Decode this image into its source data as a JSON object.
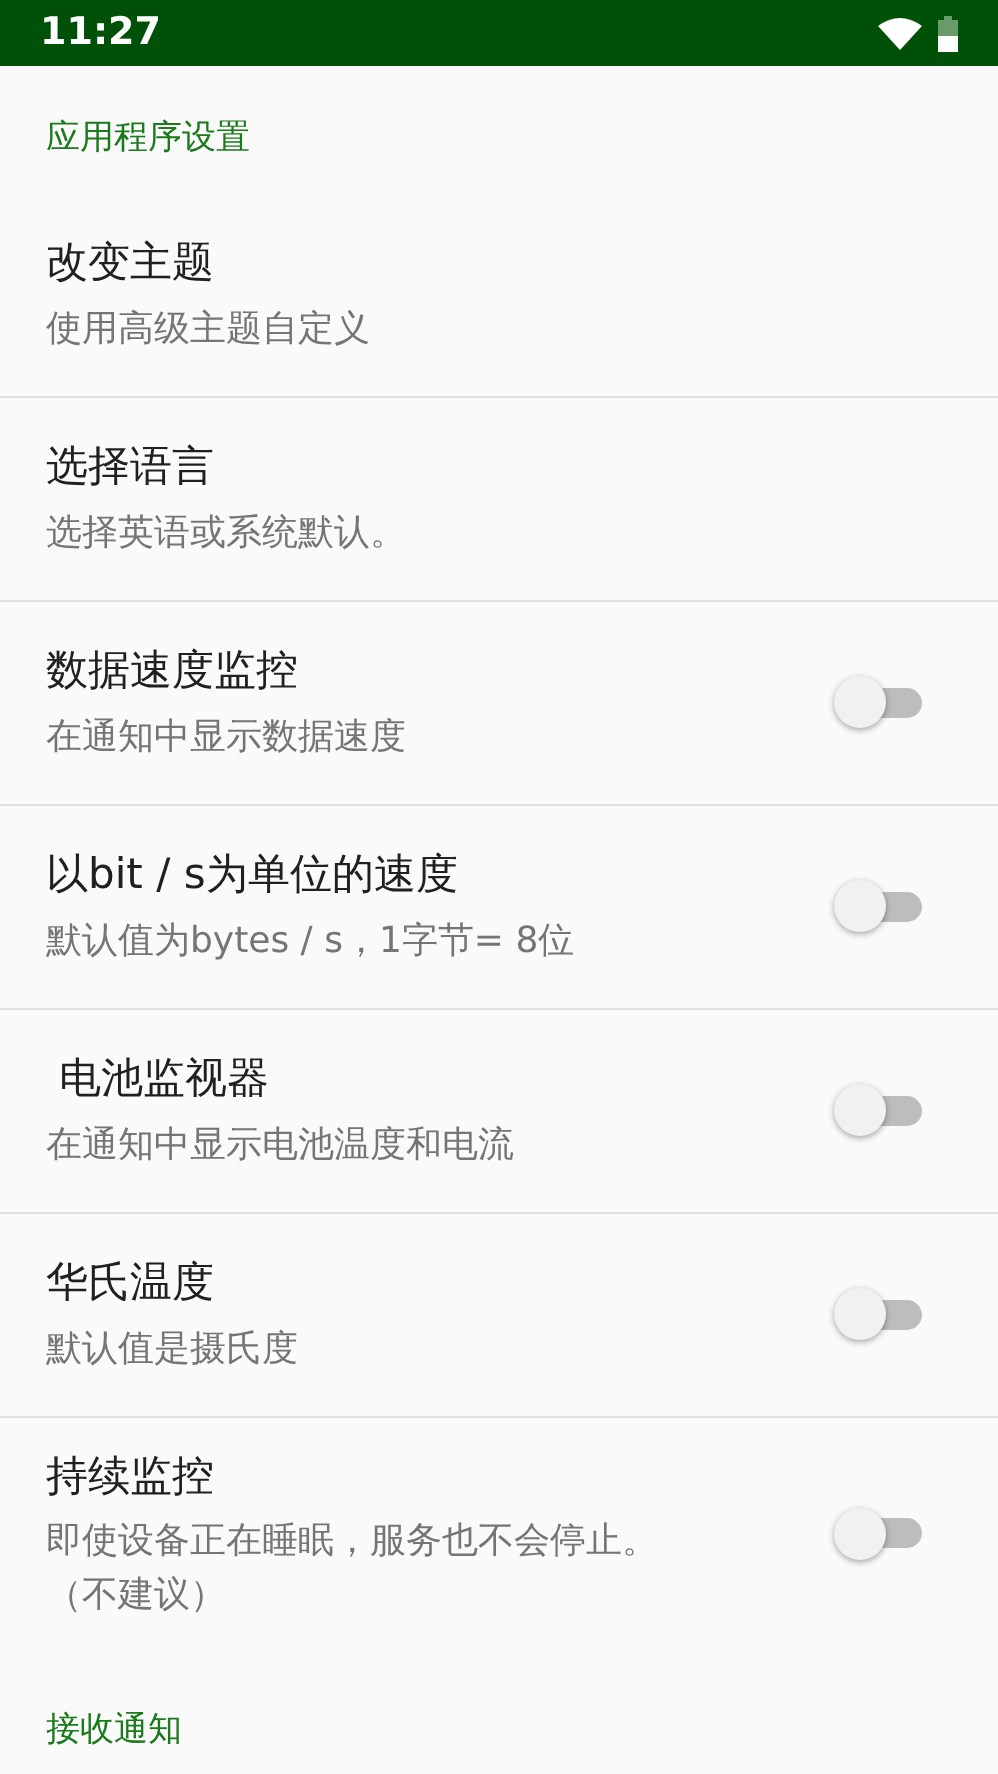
{
  "status_bar": {
    "time": "11:27"
  },
  "sections": [
    {
      "title": "应用程序设置",
      "items": [
        {
          "kind": "link",
          "title": "改变主题",
          "subtitle": "使用高级主题自定义"
        },
        {
          "kind": "link",
          "title": "选择语言",
          "subtitle": "选择英语或系统默认。"
        },
        {
          "kind": "switch",
          "title": "数据速度监控",
          "subtitle": "在通知中显示数据速度",
          "on": false
        },
        {
          "kind": "switch",
          "title": "以bit / s为单位的速度",
          "subtitle": "默认值为bytes / s，1字节= 8位",
          "on": false
        },
        {
          "kind": "switch",
          "title": " 电池监视器",
          "subtitle": "在通知中显示电池温度和电流",
          "on": false
        },
        {
          "kind": "switch",
          "title": "华氏温度",
          "subtitle": "默认值是摄氏度",
          "on": false
        },
        {
          "kind": "switch",
          "title": "持续监控",
          "subtitle": "即使设备正在睡眠，服务也不会停止。（不建议）",
          "on": false
        }
      ]
    },
    {
      "title": "接收通知"
    }
  ]
}
